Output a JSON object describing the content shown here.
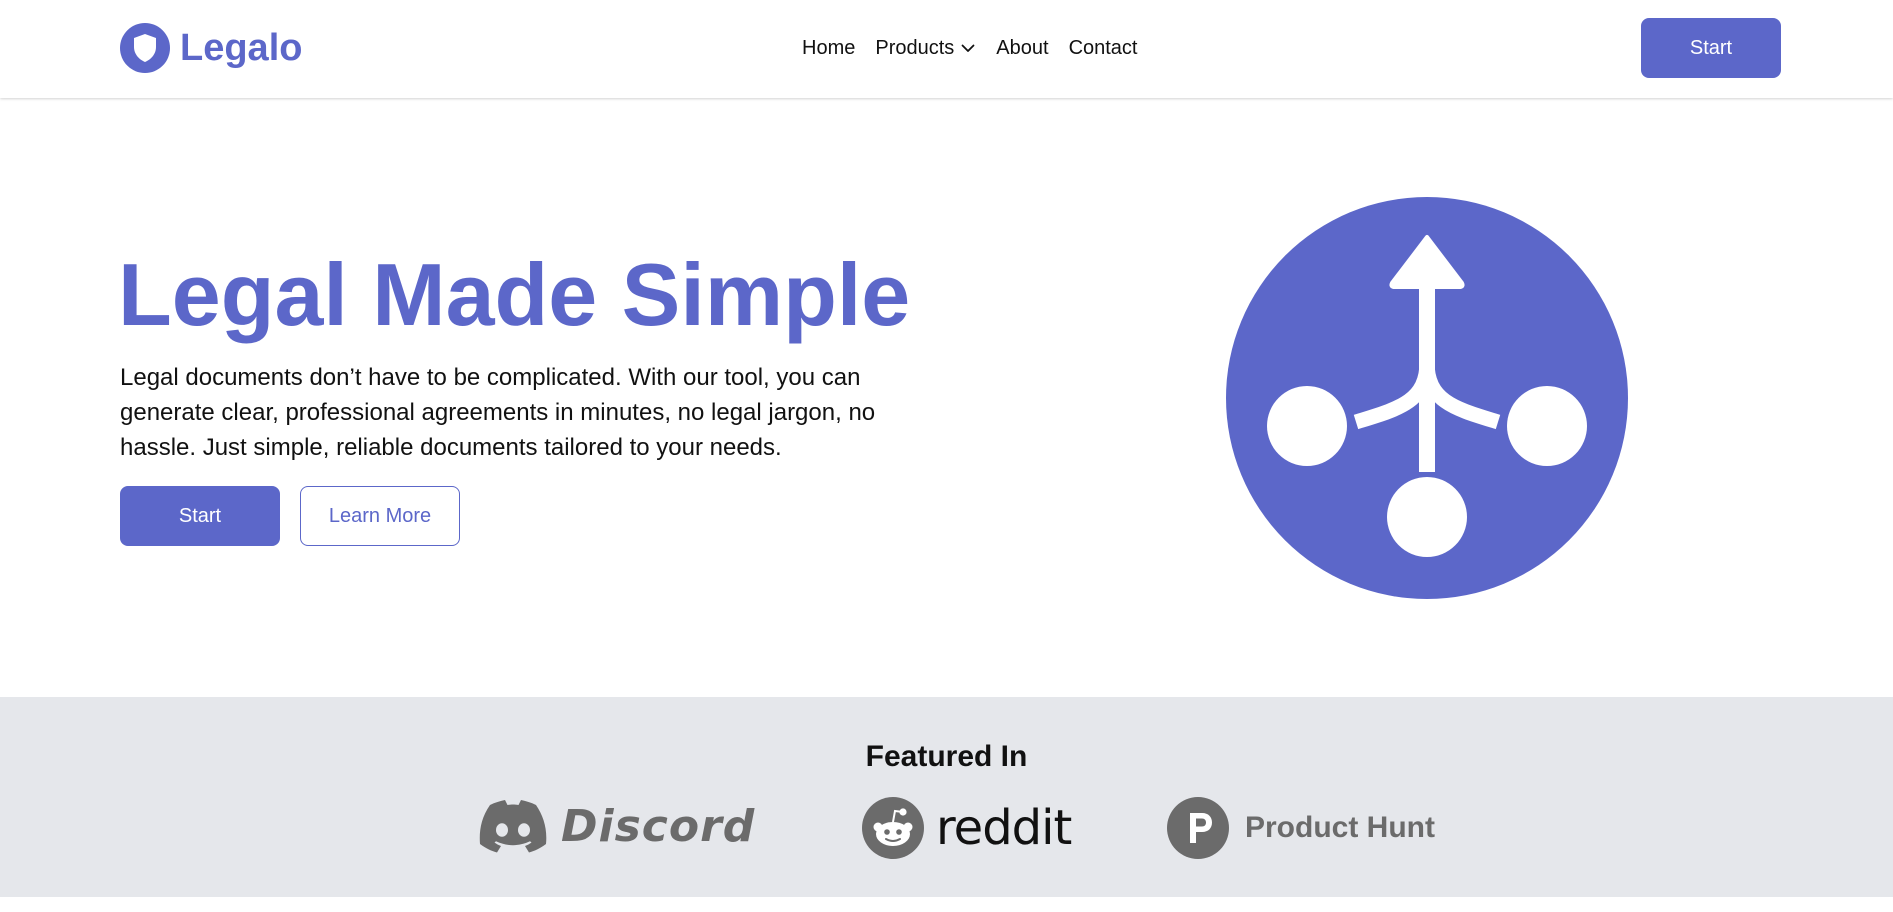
{
  "colors": {
    "brand": "#5c67c9",
    "text": "#111111",
    "featured_background": "#e5e7eb",
    "logo_gray": "#6b6b6b"
  },
  "header": {
    "brand_name": "Legalo",
    "brand_icon": "shield-icon",
    "nav": {
      "home": "Home",
      "products": "Products",
      "about": "About",
      "contact": "Contact"
    },
    "start_label": "Start"
  },
  "hero": {
    "title": "Legal Made Simple",
    "description": "Legal documents don’t have to be complicated. With our tool, you can generate clear, professional agreements in minutes, no legal jargon, no hassle. Just simple, reliable documents tailored to your needs.",
    "start_label": "Start",
    "learn_more_label": "Learn More",
    "graphic_icon": "merge-arrow-icon"
  },
  "featured": {
    "title": "Featured In",
    "logos": [
      {
        "name": "Discord",
        "icon": "discord-icon"
      },
      {
        "name": "reddit",
        "icon": "reddit-icon"
      },
      {
        "name": "Product Hunt",
        "icon": "product-hunt-icon"
      }
    ]
  }
}
